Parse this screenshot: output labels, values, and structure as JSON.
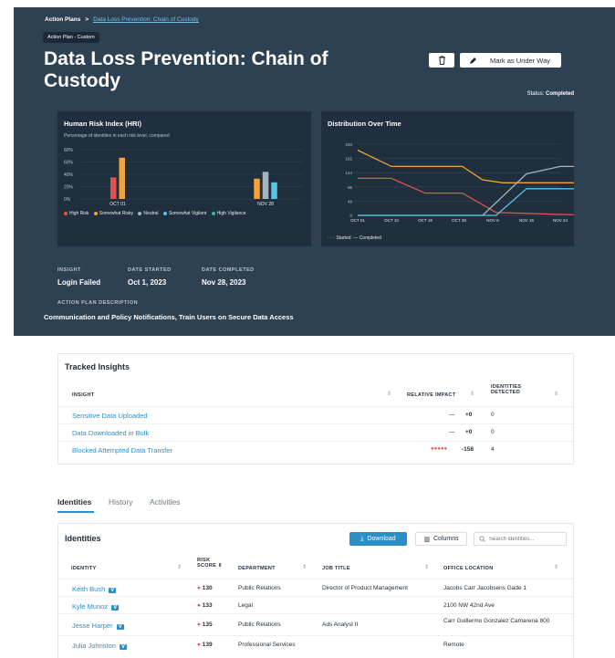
{
  "breadcrumb": {
    "root": "Action Plans",
    "sep": ">",
    "current": "Data Loss Prevention: Chain of Custody"
  },
  "header": {
    "pill": "Action Plan - Custom",
    "title": "Data Loss Prevention: Chain of Custody",
    "mark_button": "Mark as Under Way",
    "status_label": "Status:",
    "status_value": "Completed"
  },
  "hri": {
    "title": "Human Risk Index (HRI)",
    "subtitle": "Percentage of identities in each risk level, compared",
    "legend": [
      "High Risk",
      "Somewhat Risky",
      "Neutral",
      "Somewhat Vigilant",
      "High Vigilance"
    ],
    "colors": [
      "#e0524c",
      "#f2a33a",
      "#a8b3bd",
      "#58c4e6",
      "#33b7a6"
    ]
  },
  "dist": {
    "title": "Distribution Over Time",
    "legend_started": "Started",
    "legend_completed": "Completed"
  },
  "chart_data": [
    {
      "type": "bar",
      "title": "Human Risk Index (HRI)",
      "categories": [
        "OCT 01",
        "NOV 28"
      ],
      "yticks": [
        "80%",
        "60%",
        "40%",
        "20%",
        "0%"
      ],
      "ylim": [
        0,
        80
      ],
      "series": [
        {
          "name": "High Risk",
          "values": [
            35,
            0
          ]
        },
        {
          "name": "Somewhat Risky",
          "values": [
            67,
            33
          ]
        },
        {
          "name": "Neutral",
          "values": [
            0,
            44
          ]
        },
        {
          "name": "Somewhat Vigilant",
          "values": [
            0,
            27
          ]
        },
        {
          "name": "High Vigilance",
          "values": [
            0,
            0
          ]
        }
      ]
    },
    {
      "type": "line",
      "title": "Distribution Over Time",
      "categories": [
        "OCT 01",
        "OCT 10",
        "OCT 19",
        "OCT 28",
        "NOV 6",
        "NOV 15",
        "NOV 24"
      ],
      "yticks": [
        "240",
        "192",
        "144",
        "96",
        "48",
        "0"
      ],
      "ylim": [
        0,
        240
      ],
      "series": [
        {
          "color": "#f2a33a",
          "values": [
            [
              0,
              220
            ],
            [
              1,
              165
            ],
            [
              2,
              165
            ],
            [
              3.1,
              165
            ],
            [
              3.7,
              120
            ],
            [
              4.3,
              110
            ],
            [
              7,
              110
            ]
          ]
        },
        {
          "color": "#e0524c",
          "values": [
            [
              0,
              125
            ],
            [
              1,
              125
            ],
            [
              2,
              75
            ],
            [
              3.1,
              75
            ],
            [
              4.1,
              10
            ],
            [
              7,
              0
            ]
          ]
        },
        {
          "color": "#a8b3bd",
          "values": [
            [
              0,
              0
            ],
            [
              3.7,
              0
            ],
            [
              5,
              140
            ],
            [
              6,
              165
            ],
            [
              7,
              165
            ]
          ]
        },
        {
          "color": "#58c4e6",
          "values": [
            [
              0,
              0
            ],
            [
              4.1,
              0
            ],
            [
              5,
              90
            ],
            [
              7,
              90
            ]
          ]
        }
      ]
    }
  ],
  "meta": {
    "insight_label": "INSIGHT",
    "insight_value": "Login Failed",
    "started_label": "DATE STARTED",
    "started_value": "Oct 1, 2023",
    "completed_label": "DATE COMPLETED",
    "completed_value": "Nov 28, 2023",
    "desc_label": "ACTION PLAN DESCRIPTION",
    "desc_value": "Communication and Policy Notifications, Train Users on Secure Data Access"
  },
  "tracked": {
    "title": "Tracked Insights",
    "headers": {
      "insight": "INSIGHT",
      "impact": "RELATIVE IMPACT",
      "detected_1": "IDENTITIES",
      "detected_2": "DETECTED"
    },
    "rows": [
      {
        "name": "Sensitive Data Uploaded",
        "dots": "—",
        "impact": "+0",
        "detected": "0"
      },
      {
        "name": "Data Downloaded in Bulk",
        "dots": "—",
        "impact": "+0",
        "detected": "0"
      },
      {
        "name": "Blocked Attempted Data Transfer",
        "dots": "●●●●●",
        "impact": "-158",
        "detected": "4"
      }
    ]
  },
  "tabs": [
    "Identities",
    "History",
    "Activities"
  ],
  "identities": {
    "title": "Identities",
    "download": "Download",
    "columns": "Columns",
    "search_placeholder": "Search identities...",
    "headers": {
      "identity": "IDENTITY",
      "risk_1": "RISK",
      "risk_2": "SCORE",
      "department": "DEPARTMENT",
      "job": "JOB TITLE",
      "office": "OFFICE LOCATION"
    },
    "badge": "V",
    "rows": [
      {
        "name": "Keith Bush",
        "score": "130",
        "department": "Public Relations",
        "job": "Director of Product Management",
        "office": "Jacobs Carr Jacobsens Gade 1"
      },
      {
        "name": "Kyle Munoz",
        "score": "133",
        "department": "Legal",
        "job": "",
        "office": "2100 NW 42nd Ave"
      },
      {
        "name": "Jesse Harper",
        "score": "135",
        "department": "Public Relations",
        "job": "Ads Analyst II",
        "office": "Carr Guillermo Gonzalez Camarena 800"
      },
      {
        "name": "Julia Johnston",
        "score": "139",
        "department": "Professional Services",
        "job": "",
        "office": "Remote"
      }
    ]
  }
}
